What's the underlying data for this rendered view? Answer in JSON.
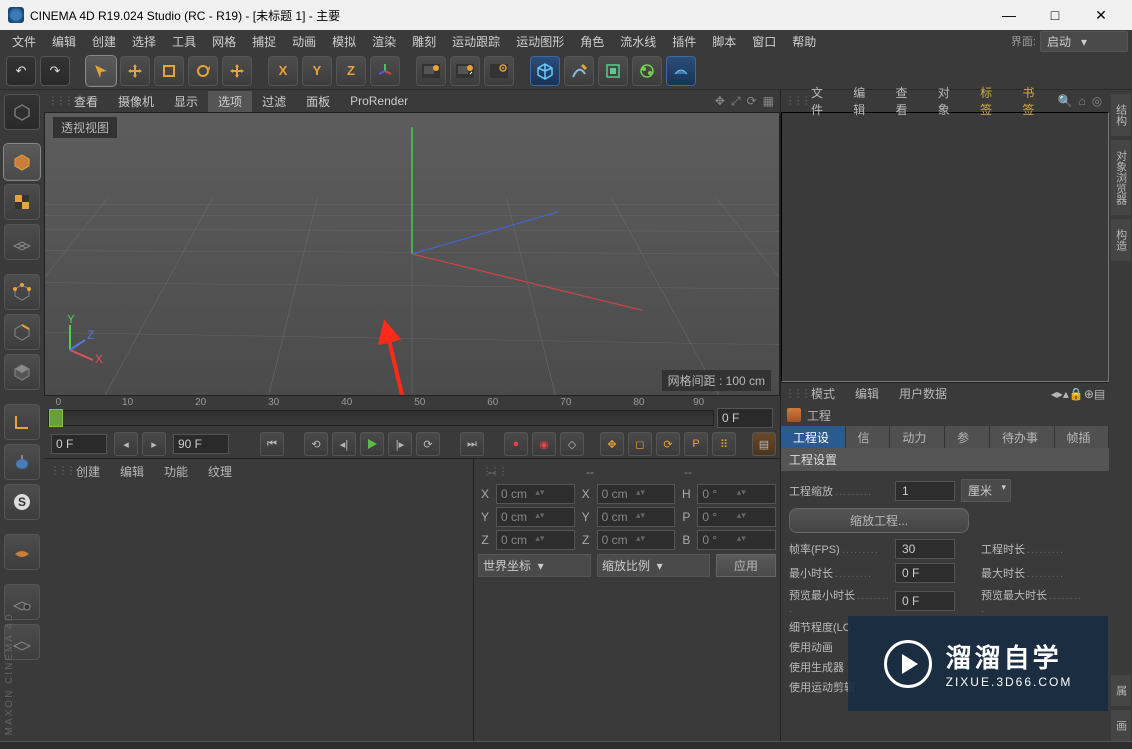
{
  "window": {
    "title": "CINEMA 4D R19.024 Studio (RC - R19) - [未标题 1] - 主要",
    "minimize": "—",
    "maximize": "□",
    "close": "✕"
  },
  "layout": {
    "label": "界面:",
    "value": "启动"
  },
  "menubar": [
    "文件",
    "编辑",
    "创建",
    "选择",
    "工具",
    "网格",
    "捕捉",
    "动画",
    "模拟",
    "渲染",
    "雕刻",
    "运动跟踪",
    "运动图形",
    "角色",
    "流水线",
    "插件",
    "脚本",
    "窗口",
    "帮助"
  ],
  "viewport_menu": {
    "items": [
      "查看",
      "摄像机",
      "显示",
      "选项",
      "过滤",
      "面板",
      "ProRender"
    ],
    "active_index": 3
  },
  "viewport": {
    "type_label": "透视视图",
    "grid_label": "网格间距 : 100 cm",
    "mini_axes": {
      "x": "X",
      "y": "Y",
      "z": "Z"
    }
  },
  "timeline": {
    "ticks": [
      "0",
      "10",
      "20",
      "30",
      "40",
      "50",
      "60",
      "70",
      "80",
      "90"
    ],
    "start": "0 F",
    "end": "90 F",
    "current": "0 F",
    "preview_end": "0 F"
  },
  "material_menu": [
    "创建",
    "编辑",
    "功能",
    "纹理"
  ],
  "coords": {
    "header_dashes": "--",
    "x": {
      "label": "X",
      "pos": "0 cm",
      "size": "0 cm",
      "h_label": "H",
      "h": "0 °"
    },
    "y": {
      "label": "Y",
      "pos": "0 cm",
      "size": "0 cm",
      "p_label": "P",
      "p": "0 °"
    },
    "z": {
      "label": "Z",
      "pos": "0 cm",
      "size": "0 cm",
      "b_label": "B",
      "b": "0 °"
    },
    "coord_space": "世界坐标",
    "scale_mode": "缩放比例",
    "apply": "应用"
  },
  "objects_menu": {
    "items": [
      "文件",
      "编辑",
      "查看",
      "对象",
      "标签",
      "书签"
    ],
    "gold_start": 4
  },
  "attr_menu": [
    "模式",
    "编辑",
    "用户数据"
  ],
  "attr_title": "工程",
  "attr_tabs": {
    "items": [
      "工程设置",
      "信息",
      "动力学",
      "参考",
      "待办事项",
      "帧插值"
    ],
    "active_index": 0
  },
  "attr_group": "工程设置",
  "project": {
    "scale_label": "工程缩放",
    "scale_value": "1",
    "scale_unit": "厘米",
    "scale_project_btn": "缩放工程...",
    "fps_label": "帧率(FPS)",
    "fps_value": "30",
    "duration_label": "工程时长",
    "min_time_label": "最小时长",
    "min_time_value": "0 F",
    "max_time_label": "最大时长",
    "preview_min_label": "预览最小时长",
    "preview_min_value": "0 F",
    "preview_max_label": "预览最大时长",
    "lod_label": "细节程度(LO",
    "use_anim_label": "使用动画",
    "use_gen_label": "使用生成器",
    "use_motion_label": "使用运动剪辑"
  },
  "right_tabs": [
    "结构",
    "对象浏览器",
    "构造",
    "属",
    "画"
  ],
  "watermark": {
    "big": "溜溜自学",
    "small": "ZIXUE.3D66.COM"
  },
  "branding": "MAXON  CINEMA 4D"
}
